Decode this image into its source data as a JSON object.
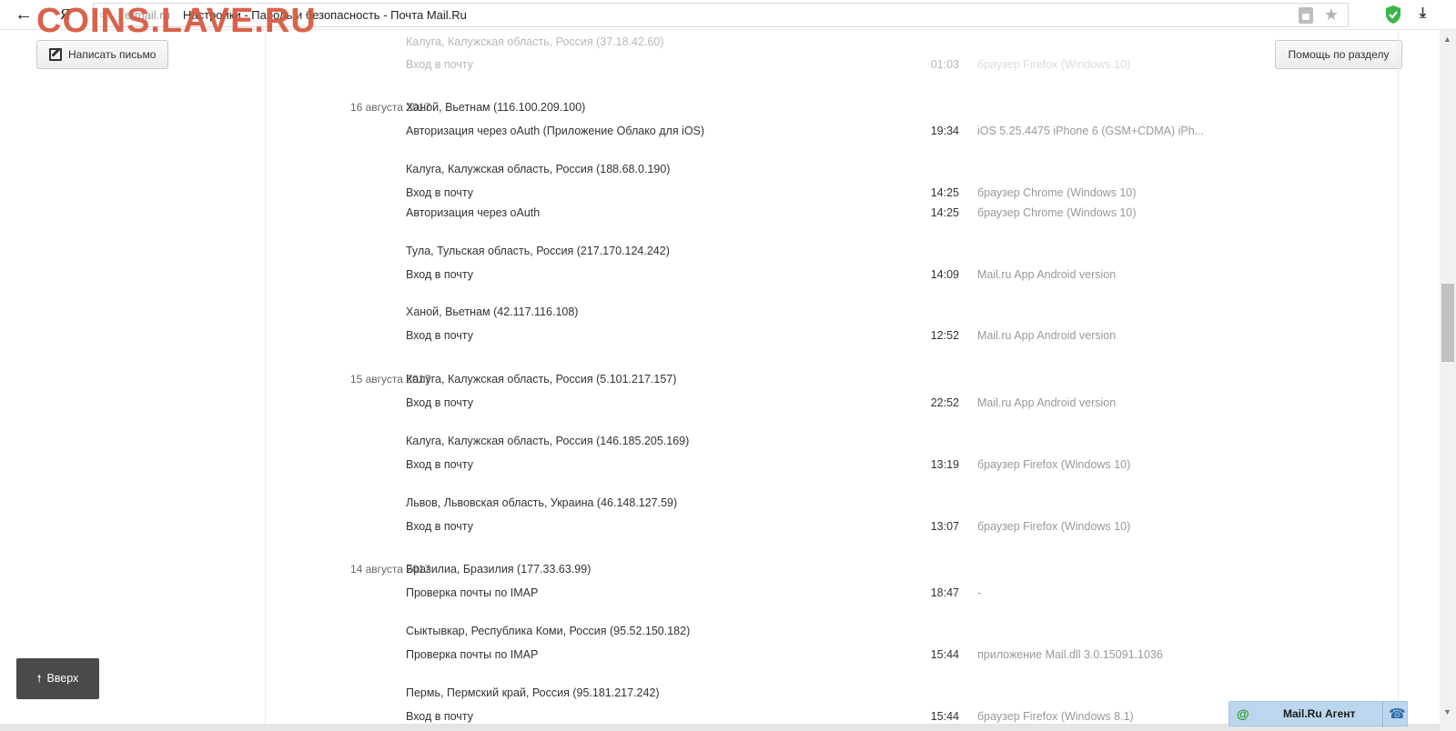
{
  "browser": {
    "logo": "Я",
    "url_domain": "e.mail.ru",
    "page_title": "Настройки - Пароль и безопасность - Почта Mail.Ru"
  },
  "watermark": "COINS.LAVE.RU",
  "compose_label": "Написать письмо",
  "help_label": "Помощь по разделу",
  "up_label": "Вверх",
  "agent": {
    "title": "Mail.Ru Агент"
  },
  "entries": [
    {
      "date": "",
      "location": "Калуга, Калужская область, Россия (37.18.42.60)",
      "faded": true
    },
    {
      "action": "Вход в почту",
      "time": "01:03",
      "client": "браузер Firefox (Windows 10)",
      "faded": true
    },
    {
      "date": "16 августа 2017",
      "location": "Ханой, Вьетнам (116.100.209.100)"
    },
    {
      "action": "Авторизация через oAuth (Приложение Облако для iOS)",
      "time": "19:34",
      "client": "iOS 5.25.4475 iPhone 6 (GSM+CDMA) iPh..."
    },
    {
      "location": "Калуга, Калужская область, Россия (188.68.0.190)"
    },
    {
      "action": "Вход в почту",
      "time": "14:25",
      "client": "браузер Chrome (Windows 10)"
    },
    {
      "action": "Авторизация через oAuth",
      "time": "14:25",
      "client": "браузер Chrome (Windows 10)"
    },
    {
      "location": "Тула, Тульская область, Россия (217.170.124.242)"
    },
    {
      "action": "Вход в почту",
      "time": "14:09",
      "client": "Mail.ru App Android version"
    },
    {
      "location": "Ханой, Вьетнам (42.117.116.108)"
    },
    {
      "action": "Вход в почту",
      "time": "12:52",
      "client": "Mail.ru App Android version"
    },
    {
      "date": "15 августа 2017",
      "location": "Калуга, Калужская область, Россия (5.101.217.157)"
    },
    {
      "action": "Вход в почту",
      "time": "22:52",
      "client": "Mail.ru App Android version"
    },
    {
      "location": "Калуга, Калужская область, Россия (146.185.205.169)"
    },
    {
      "action": "Вход в почту",
      "time": "13:19",
      "client": "браузер Firefox (Windows 10)"
    },
    {
      "location": "Львов, Львовская область, Украина (46.148.127.59)"
    },
    {
      "action": "Вход в почту",
      "time": "13:07",
      "client": "браузер Firefox (Windows 10)"
    },
    {
      "date": "14 августа 2017",
      "location": "Бразилиа, Бразилия (177.33.63.99)"
    },
    {
      "action": "Проверка почты по IMAP",
      "time": "18:47",
      "client": "-"
    },
    {
      "location": "Сыктывкар, Республика Коми, Россия (95.52.150.182)"
    },
    {
      "action": "Проверка почты по IMAP",
      "time": "15:44",
      "client": "приложение Mail.dll 3.0.15091.1036"
    },
    {
      "location": "Пермь, Пермский край, Россия (95.181.217.242)"
    },
    {
      "action": "Вход в почту",
      "time": "15:44",
      "client": "браузер Firefox (Windows 8.1)"
    }
  ]
}
